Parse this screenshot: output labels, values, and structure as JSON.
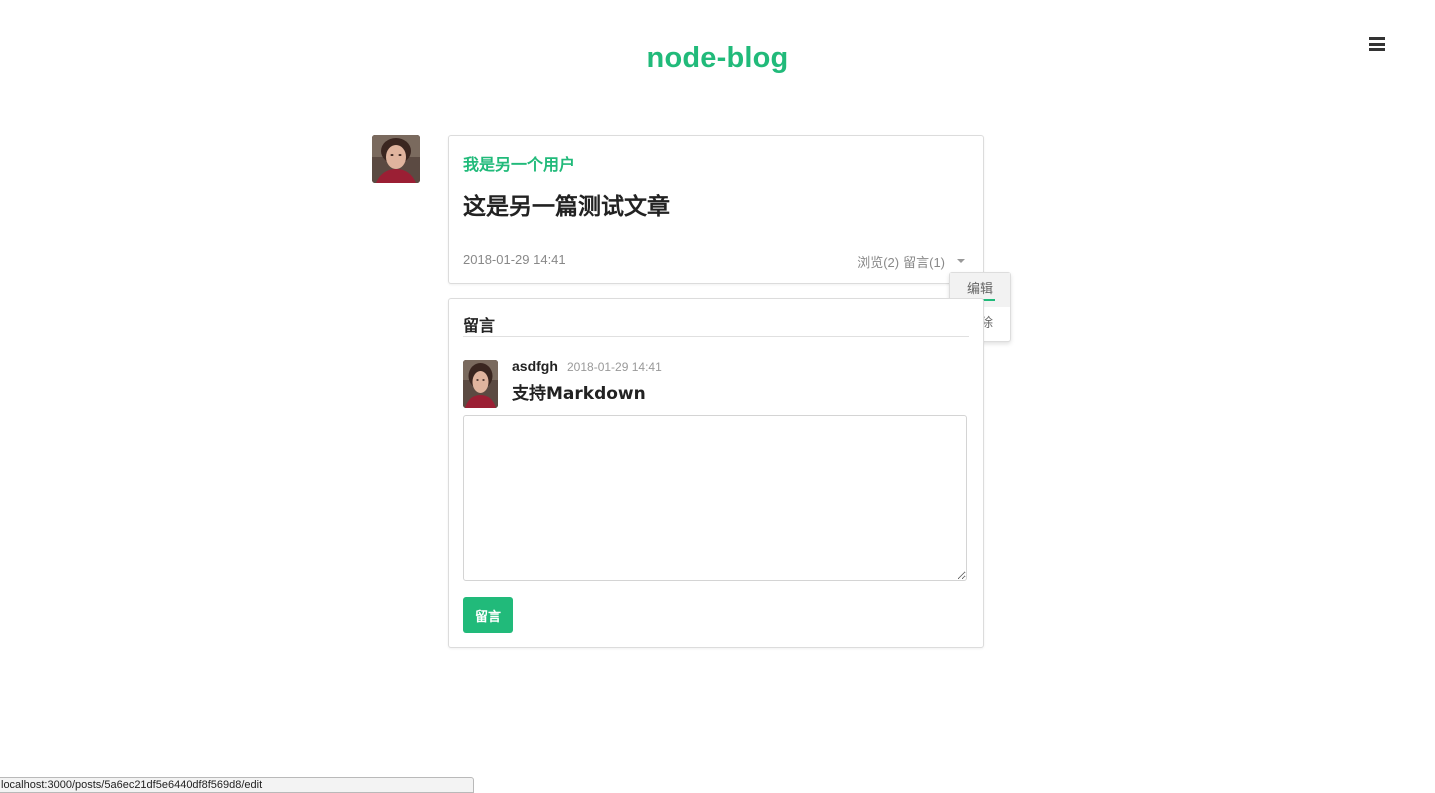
{
  "header": {
    "site_title": "node-blog",
    "menu_icon": "hamburger-menu-icon"
  },
  "post": {
    "author": "我是另一个用户",
    "title": "这是另一篇测试文章",
    "date": "2018-01-29 14:41",
    "views_label": "浏览(2)",
    "comments_label": "留言(1)",
    "dropdown_icon": "caret-down-icon"
  },
  "dropdown": {
    "items": [
      {
        "label": "编辑",
        "active": true
      },
      {
        "label": "删除",
        "active": false
      }
    ]
  },
  "comments": {
    "header": "留言",
    "list": [
      {
        "author": "asdfgh",
        "date": "2018-01-29 14:41",
        "content": "支持Markdown"
      }
    ],
    "textarea_value": "",
    "submit_label": "留言"
  },
  "status_bar": {
    "url": "localhost:3000/posts/5a6ec21df5e6440df8f569d8/edit"
  },
  "colors": {
    "brand": "#21ba7a",
    "text": "#222222",
    "muted": "#888888",
    "border": "#dcdcdc"
  }
}
